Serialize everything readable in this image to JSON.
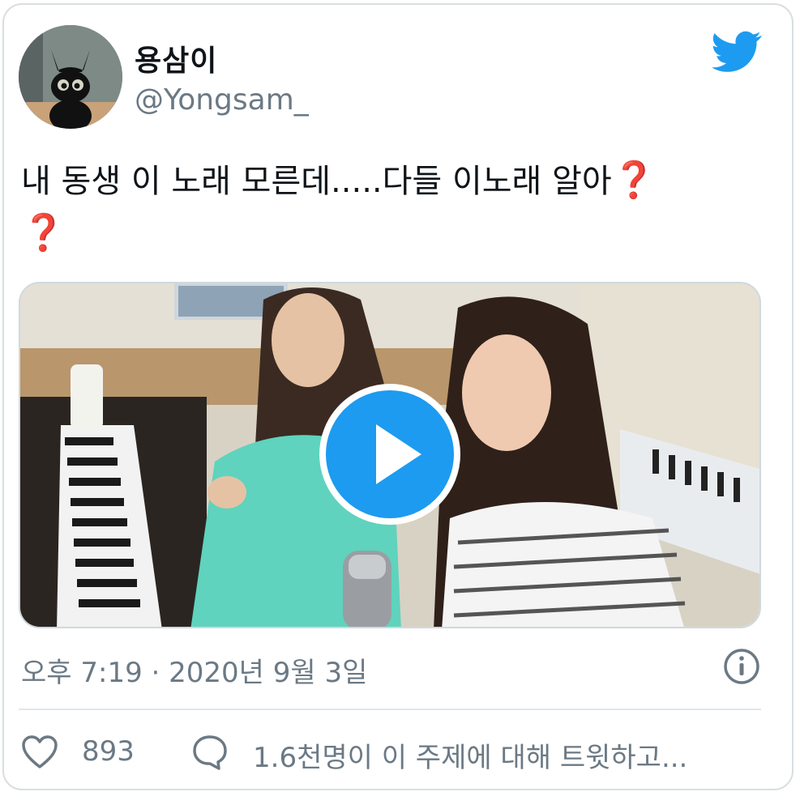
{
  "user": {
    "display_name": "용삼이",
    "handle": "@Yongsam_",
    "avatar_icon": "black-cat-avatar"
  },
  "brand": {
    "logo_icon": "twitter-bird-icon",
    "color": "#1d9bf0"
  },
  "tweet": {
    "text": "내 동생 이 노래 모른데.....다들 이노래 알아",
    "emoji_1": "❓",
    "emoji_2": "❓"
  },
  "media": {
    "type": "video",
    "play_icon": "play-icon"
  },
  "meta": {
    "timestamp": "오후 7:19 · 2020년 9월 3일",
    "info_icon": "info-icon"
  },
  "actions": {
    "like_icon": "heart-icon",
    "like_count": "893",
    "reply_icon": "speech-bubble-icon",
    "discussion_text": "1.6천명이 이 주제에 대해 트윗하고..."
  },
  "colors": {
    "text": "#0f1419",
    "secondary": "#6b7984",
    "question_mark": "#c8193c"
  }
}
